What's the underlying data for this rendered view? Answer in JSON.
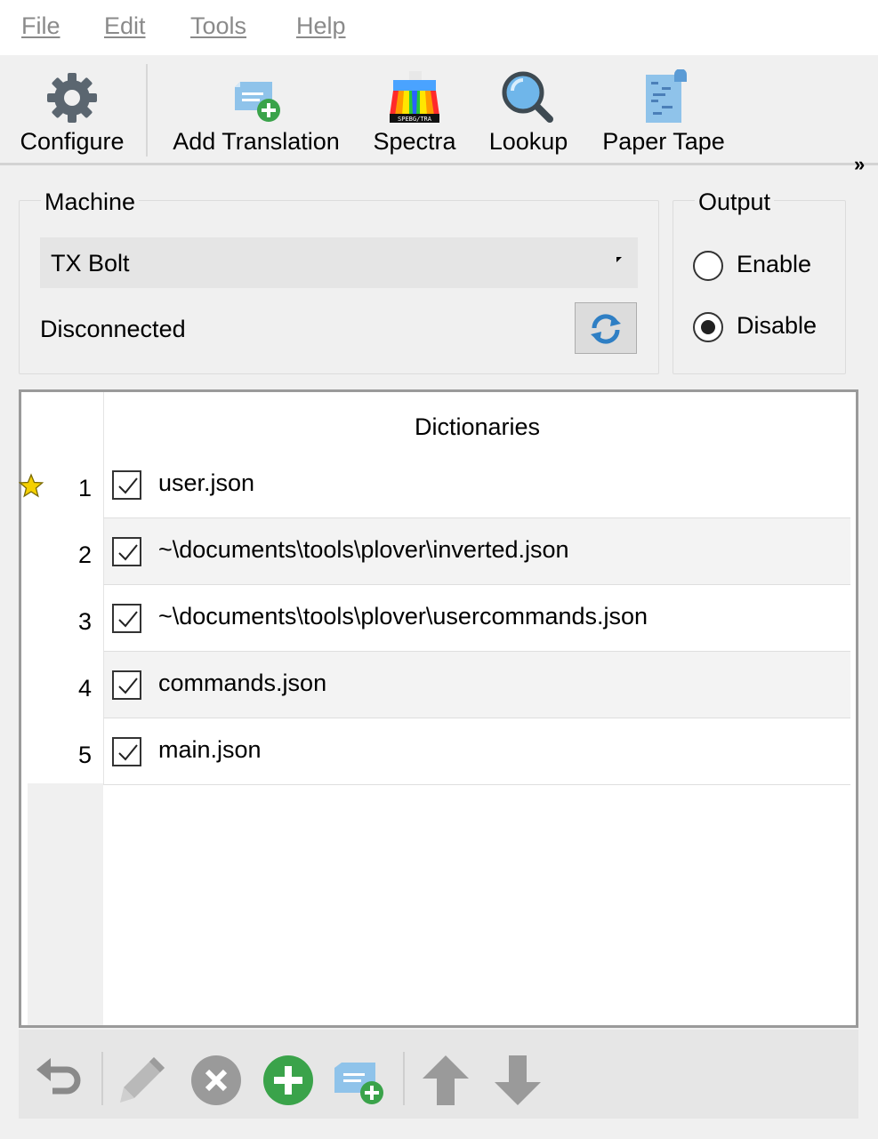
{
  "menu": {
    "items": [
      {
        "label": "File"
      },
      {
        "label": "Edit"
      },
      {
        "label": "Tools"
      },
      {
        "label": "Help"
      }
    ]
  },
  "toolbar": {
    "configure": "Configure",
    "add_translation": "Add Translation",
    "spectra": "Spectra",
    "spectra_icon_text": "SPEBG/TRA",
    "lookup": "Lookup",
    "paper_tape": "Paper Tape",
    "overflow": "»"
  },
  "machine": {
    "title": "Machine",
    "selected": "TX Bolt",
    "status": "Disconnected"
  },
  "output": {
    "title": "Output",
    "enable_label": "Enable",
    "disable_label": "Disable",
    "selected": "Disable"
  },
  "dictionaries": {
    "header": "Dictionaries",
    "rows": [
      {
        "num": "1",
        "name": "user.json",
        "checked": true,
        "favorite": true
      },
      {
        "num": "2",
        "name": "~\\documents\\tools\\plover\\inverted.json",
        "checked": true
      },
      {
        "num": "3",
        "name": "~\\documents\\tools\\plover\\usercommands.json",
        "checked": true
      },
      {
        "num": "4",
        "name": "commands.json",
        "checked": true
      },
      {
        "num": "5",
        "name": "main.json",
        "checked": true
      }
    ]
  },
  "colors": {
    "accent_blue": "#5b9bd5",
    "green": "#3aa34a",
    "gray_icon": "#9a9a9a",
    "star_yellow": "#f5d000"
  }
}
